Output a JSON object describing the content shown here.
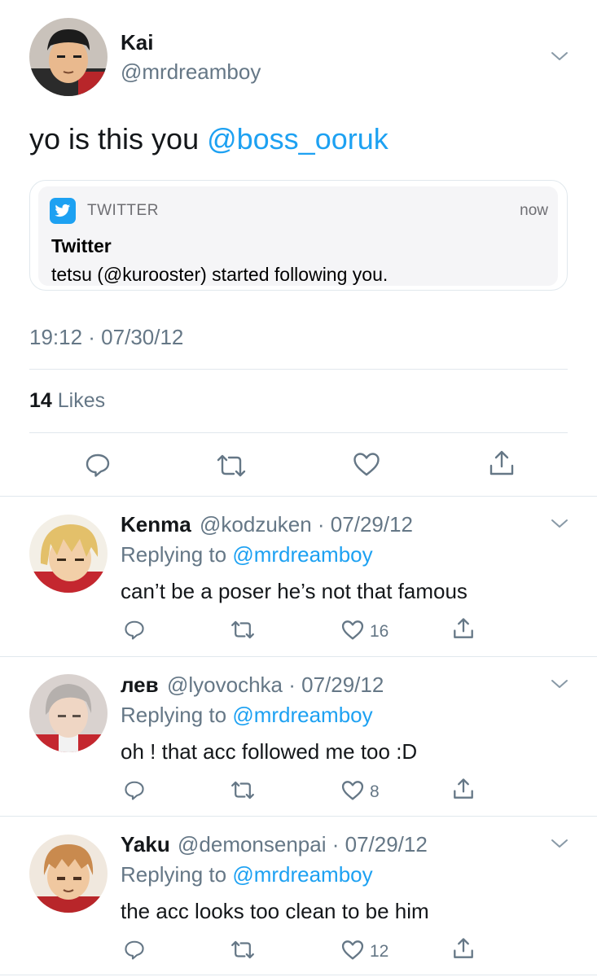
{
  "tweet": {
    "author_name": "Kai",
    "author_handle": "@mrdreamboy",
    "text": "yo is this you ",
    "text_mention": "@boss_ooruk",
    "timestamp": "19:12 · 07/30/12",
    "likes_count": "14",
    "likes_label": "Likes"
  },
  "notification": {
    "app_name": "TWITTER",
    "time": "now",
    "title": "Twitter",
    "body": "tetsu (@kurooster) started following you."
  },
  "replies": [
    {
      "name": "Kenma",
      "handle_date": "@kodzuken · 07/29/12",
      "replying_label": "Replying to ",
      "replying_to": "@mrdreamboy",
      "text": "can’t be a poser he’s not that famous",
      "likes": "16"
    },
    {
      "name": "лев",
      "handle_date": "@lyovochka · 07/29/12",
      "replying_label": "Replying to ",
      "replying_to": "@mrdreamboy",
      "text": "oh ! that acc followed me too :D",
      "likes": "8"
    },
    {
      "name": "Yaku",
      "handle_date": "@demonsenpai · 07/29/12",
      "replying_label": "Replying to ",
      "replying_to": "@mrdreamboy",
      "text": "the acc looks too clean to be him",
      "likes": "12"
    }
  ],
  "colors": {
    "accent": "#1da1f2",
    "secondary_text": "#657786",
    "primary_text": "#14171a",
    "divider": "#e1e8ed"
  },
  "icons": [
    "chevron-down-icon",
    "reply-icon",
    "retweet-icon",
    "like-icon",
    "share-icon",
    "twitter-bird-icon"
  ]
}
